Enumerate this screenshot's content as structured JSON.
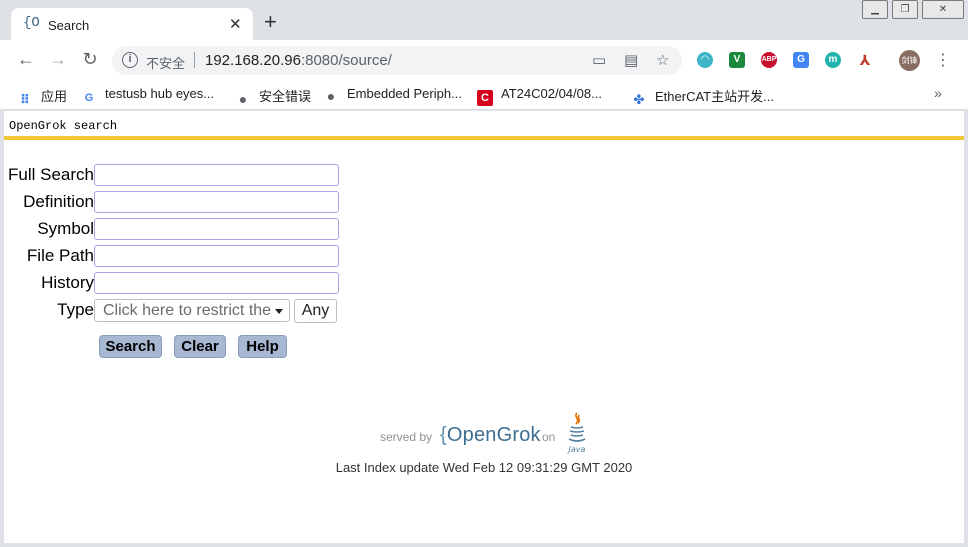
{
  "window": {
    "tab_title": "Search",
    "tab_favicon": "{O",
    "controls": [
      "minimize",
      "maximize",
      "close"
    ]
  },
  "toolbar": {
    "insecure_label": "不安全",
    "url_host": "192.168.20.96",
    "url_rest": ":8080/source/"
  },
  "bookmarks": [
    {
      "label": "应用",
      "icon": "apps-icon"
    },
    {
      "label": "testusb hub eyes...",
      "icon": "google-icon"
    },
    {
      "label": "安全错误",
      "icon": "globe-icon"
    },
    {
      "label": "Embedded Periph...",
      "icon": "globe-icon"
    },
    {
      "label": "AT24C02/04/08...",
      "icon": "c-logo-icon"
    },
    {
      "label": "EtherCAT主站开发...",
      "icon": "paw-icon"
    }
  ],
  "profile": {
    "avatar_text": "剑锋"
  },
  "page": {
    "header_text": "OpenGrok search",
    "form": {
      "fields": [
        {
          "label": "Full Search",
          "value": ""
        },
        {
          "label": "Definition",
          "value": ""
        },
        {
          "label": "Symbol",
          "value": ""
        },
        {
          "label": "File Path",
          "value": ""
        },
        {
          "label": "History",
          "value": ""
        }
      ],
      "type_label": "Type",
      "type_placeholder": "Click here to restrict the",
      "type_any": "Any"
    },
    "buttons": {
      "search": "Search",
      "clear": "Clear",
      "help": "Help"
    },
    "footer": {
      "served_by": "served by",
      "brand": "OpenGrok",
      "on": "on",
      "java": "Java",
      "last_index": "Last Index update Wed Feb 12 09:31:29 GMT 2020"
    }
  },
  "colors": {
    "header_rule": "#f6c637",
    "button_bg": "#a8b8d2",
    "input_border": "#a9a5e6",
    "brand_blue": "#3f6e90"
  }
}
